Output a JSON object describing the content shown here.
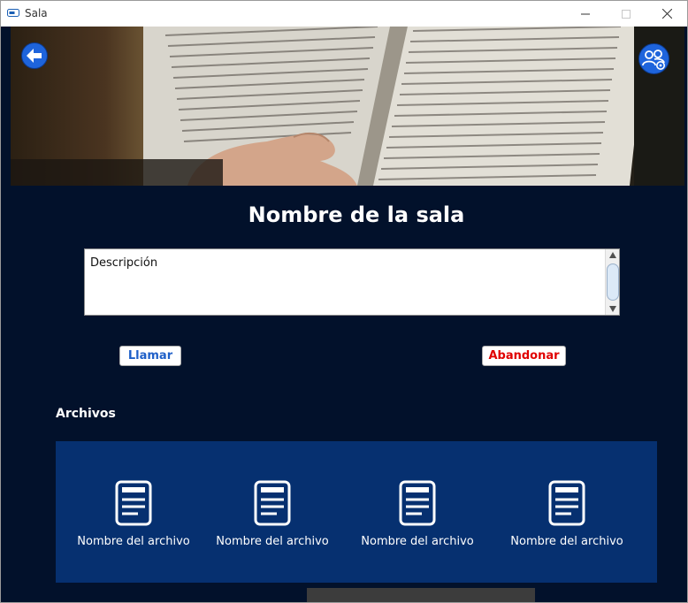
{
  "window": {
    "title": "Sala"
  },
  "header": {
    "back_icon": "arrow-left-icon",
    "settings_icon": "users-gear-icon"
  },
  "room": {
    "name": "Nombre de la sala",
    "description": "Descripción"
  },
  "actions": {
    "call_label": "Llamar",
    "leave_label": "Abandonar"
  },
  "files": {
    "heading": "Archivos",
    "items": [
      {
        "name": "Nombre del archivo",
        "icon": "document-icon"
      },
      {
        "name": "Nombre del archivo",
        "icon": "document-icon"
      },
      {
        "name": "Nombre del archivo",
        "icon": "document-icon"
      },
      {
        "name": "Nombre del archivo",
        "icon": "document-icon"
      }
    ]
  },
  "colors": {
    "background": "#02112b",
    "files_panel": "#063070",
    "accent_blue": "#1e64dc",
    "call_text": "#1e5fc8",
    "leave_text": "#e00000"
  }
}
